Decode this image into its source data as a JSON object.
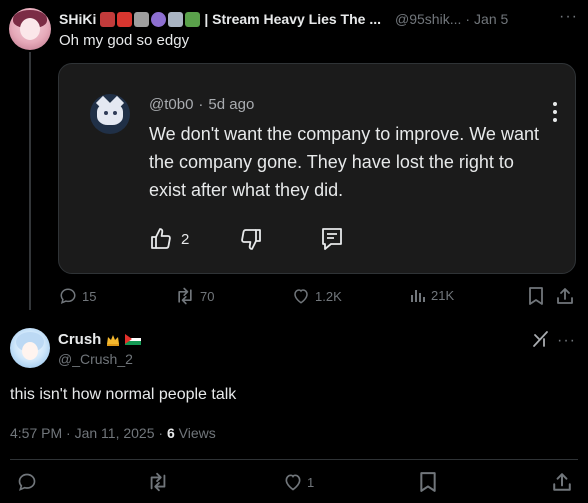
{
  "parent_post": {
    "author_name": "SHiKi",
    "header_title": "| Stream Heavy Lies The ...",
    "handle": "@95shik...",
    "separator": "·",
    "date": "Jan 5",
    "text": "Oh my god so edgy",
    "emoji_colors": [
      "#c23b3b",
      "#d8362f",
      "#9e9e9e",
      "#8d6fd1",
      "#a9b4c2",
      "#5aa14b"
    ],
    "embedded_comment": {
      "handle": "@t0b0",
      "separator": "·",
      "age": "5d ago",
      "body": "We don't want the company to improve. We want the company gone. They have lost the right to exist after what they did.",
      "like_count": "2"
    },
    "metrics": {
      "replies": "15",
      "reposts": "70",
      "likes": "1.2K",
      "views": "21K"
    }
  },
  "main_post": {
    "author_name": "Crush",
    "handle": "@_Crush_2",
    "text": "this isn't how normal people talk",
    "time": "4:57 PM · Jan 11, 2025 · ",
    "views_count": "6",
    "views_label": " Views",
    "likes": "1"
  },
  "colors": {
    "background": "#000000",
    "text": "#e7e9ea",
    "muted": "#71767b",
    "embed_bg": "#1b1b1b",
    "border": "#2f3336"
  }
}
